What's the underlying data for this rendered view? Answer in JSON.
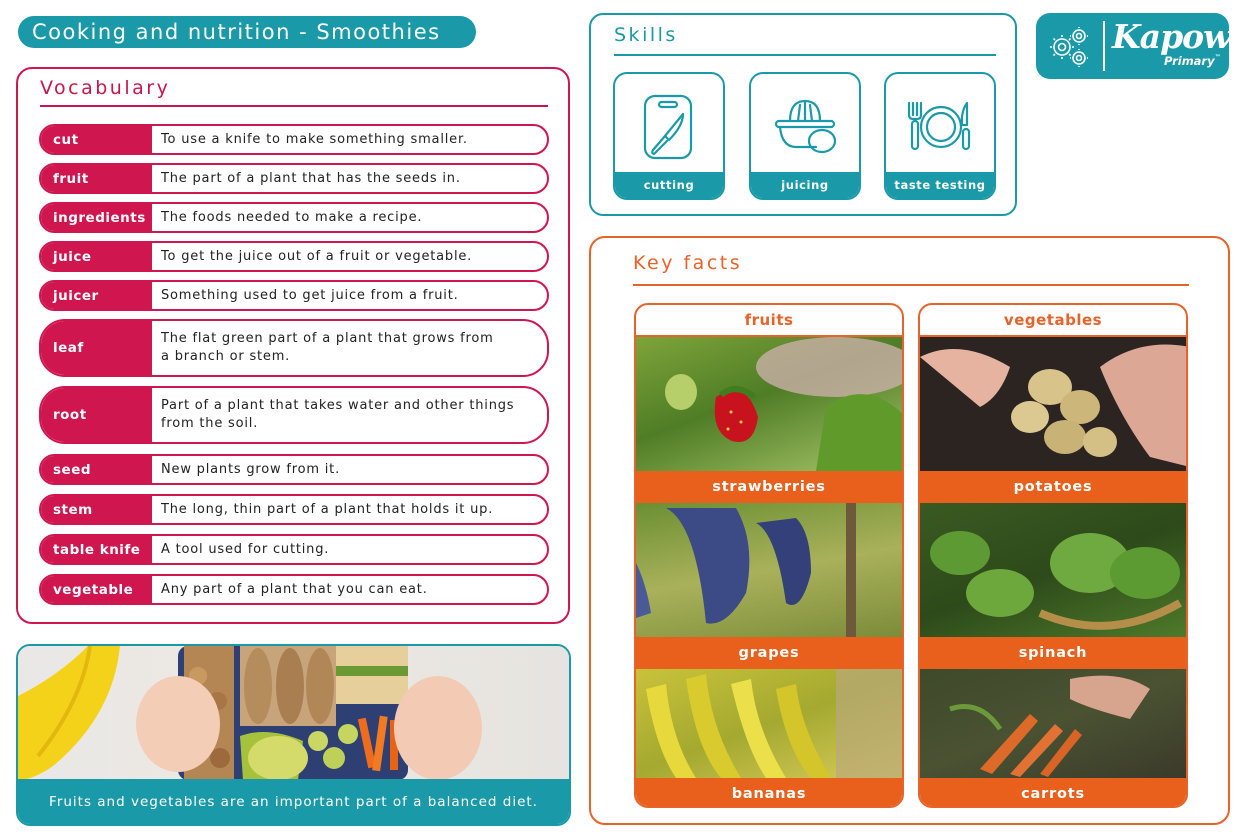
{
  "title": "Cooking and nutrition - Smoothies",
  "colors": {
    "teal": "#1a9aa8",
    "crimson": "#d0164f",
    "orange": "#e8632a"
  },
  "vocabulary": {
    "heading": "Vocabulary",
    "items": [
      {
        "term": "cut",
        "definition": "To use a knife to make something smaller."
      },
      {
        "term": "fruit",
        "definition": "The part of a plant that has the seeds in."
      },
      {
        "term": "ingredients",
        "definition": "The foods needed to make a recipe."
      },
      {
        "term": "juice",
        "definition": "To get the juice out of a fruit or vegetable."
      },
      {
        "term": "juicer",
        "definition": "Something used to get juice from a fruit."
      },
      {
        "term": "leaf",
        "definition": "The flat green part of a plant that grows from a branch or stem."
      },
      {
        "term": "root",
        "definition": "Part of a plant that takes water and other things from the soil."
      },
      {
        "term": "seed",
        "definition": "New plants grow from it."
      },
      {
        "term": "stem",
        "definition": "The long, thin part of a plant that holds it up."
      },
      {
        "term": "table knife",
        "definition": "A tool used for cutting."
      },
      {
        "term": "vegetable",
        "definition": "Any part of a plant that you can eat."
      }
    ]
  },
  "diet_banner": {
    "caption": "Fruits and vegetables are an important part of a balanced diet.",
    "photo": "child-hands-lunchbox-photo"
  },
  "skills": {
    "heading": "Skills",
    "items": [
      {
        "label": "cutting",
        "icon": "cutting-board-knife-icon"
      },
      {
        "label": "juicing",
        "icon": "citrus-juicer-icon"
      },
      {
        "label": "taste testing",
        "icon": "plate-fork-knife-icon"
      }
    ]
  },
  "logo": {
    "brand": "Kapow",
    "sub": "Primary",
    "tm": "™",
    "icon": "gears-icon"
  },
  "key_facts": {
    "heading": "Key facts",
    "columns": [
      {
        "title": "fruits",
        "items": [
          {
            "label": "strawberries",
            "photo": "strawberries-photo"
          },
          {
            "label": "grapes",
            "photo": "grapes-photo"
          },
          {
            "label": "bananas",
            "photo": "bananas-photo"
          }
        ]
      },
      {
        "title": "vegetables",
        "items": [
          {
            "label": "potatoes",
            "photo": "potatoes-photo"
          },
          {
            "label": "spinach",
            "photo": "spinach-photo"
          },
          {
            "label": "carrots",
            "photo": "carrots-photo"
          }
        ]
      }
    ]
  }
}
